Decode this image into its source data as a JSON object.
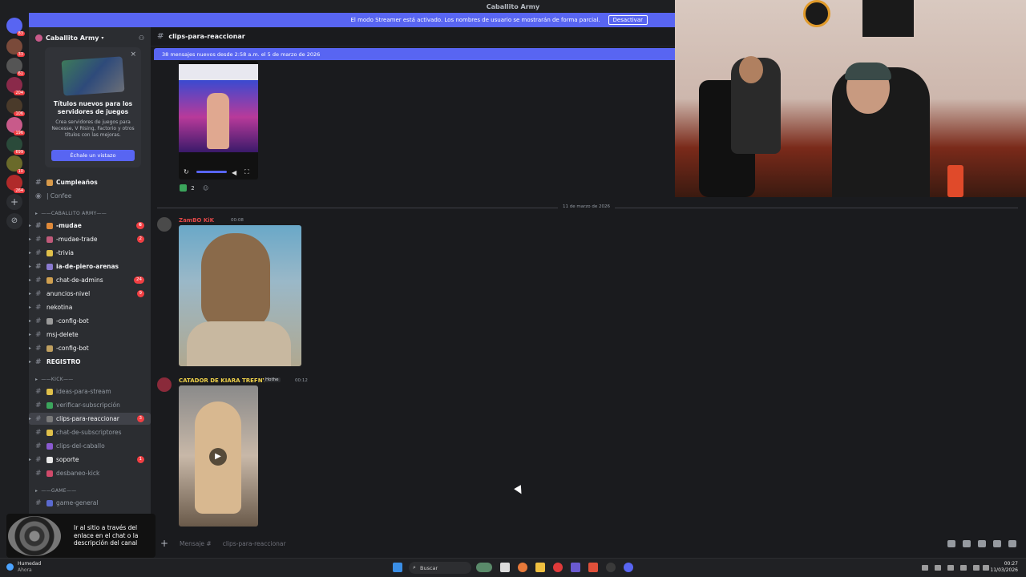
{
  "window": {
    "title": "Caballito Army"
  },
  "streamer_banner": {
    "text": "El modo Streamer está activado. Los nombres de usuario se mostrarán de forma parcial.",
    "button": "Desactivar"
  },
  "guild": {
    "name": "Caballito Army"
  },
  "promo": {
    "title": "Títulos nuevos para los servidores de juegos",
    "description": "Crea servidores de juegos para Necesse, V Rising, Factorio y otros títulos con las mejoras.",
    "cta": "Échale un vistazo",
    "close": "×"
  },
  "channels": {
    "top": [
      {
        "label": "Cumpleaños",
        "style": "bold"
      },
      {
        "label": "| Confee",
        "style": "dim"
      }
    ],
    "category_army": "——CABALLITO ARMY——",
    "army": [
      {
        "label": "-mudae",
        "badge": "6",
        "style": "bold"
      },
      {
        "label": "-mudae-trade",
        "badge": "2",
        "style": "bright"
      },
      {
        "label": "-trivia",
        "badge": "",
        "style": "bright"
      },
      {
        "label": "ia-de-piero-arenas",
        "badge": "",
        "style": "bold"
      },
      {
        "label": "chat-de-admins",
        "badge": "24",
        "style": "bright"
      },
      {
        "label": "anuncios-nivel",
        "badge": "9",
        "style": "bright"
      },
      {
        "label": "nekotina",
        "badge": "",
        "style": "bright"
      },
      {
        "label": "-config-bot",
        "badge": "",
        "style": "bright"
      },
      {
        "label": "msj-delete",
        "badge": "",
        "style": "bright"
      },
      {
        "label": "-config-bot",
        "badge": "",
        "style": "bright"
      },
      {
        "label": "REGISTRO",
        "badge": "",
        "style": "bold"
      }
    ],
    "category_kick": "——KICK——",
    "kick": [
      {
        "label": "ideas-para-stream",
        "badge": "",
        "style": "dim"
      },
      {
        "label": "verificar-subscripción",
        "badge": "",
        "style": "dim"
      },
      {
        "label": "clips-para-reaccionar",
        "badge": "3",
        "style": "active"
      },
      {
        "label": "chat-de-subscriptores",
        "badge": "",
        "style": "dim"
      },
      {
        "label": "clips-del-caballo",
        "badge": "",
        "style": "dim"
      },
      {
        "label": "soporte",
        "badge": "1",
        "style": "bright"
      },
      {
        "label": "desbaneo-kick",
        "badge": "",
        "style": "dim"
      }
    ],
    "category_game": "——GAME——",
    "game": [
      {
        "label": "game-general",
        "badge": "",
        "style": "dim"
      }
    ]
  },
  "header": {
    "channel": "clips-para-reaccionar"
  },
  "new_messages_bar": "38 mensajes nuevos desde 2:58 a.m. el 5 de marzo de 2026",
  "messages": {
    "reaction_count": "2",
    "date_divider": "11 de marzo de 2026",
    "msg1": {
      "author": "ZamBO KiK",
      "time": "00:08",
      "author_color": "#e04848"
    },
    "msg2": {
      "author": "CATADOR DE KIARA TREFNY",
      "tag": "Hothe",
      "time": "00:12",
      "author_color": "#f0d24a"
    }
  },
  "composer": {
    "placeholder": "Mensaje #",
    "channel": "clips-para-reaccionar"
  },
  "ad": {
    "text": "Ir al sitio a través del enlace en el chat o la descripción del canal"
  },
  "taskbar": {
    "weather_title": "Humedad",
    "weather_sub": "Ahora",
    "search": "Buscar",
    "time": "00:27",
    "date": "11/03/2026"
  },
  "server_badges": [
    "83",
    "33",
    "61",
    "204",
    "106",
    "196",
    "699",
    "10",
    "264"
  ],
  "colors": {
    "accent": "#5865f2",
    "danger": "#f23f43"
  }
}
